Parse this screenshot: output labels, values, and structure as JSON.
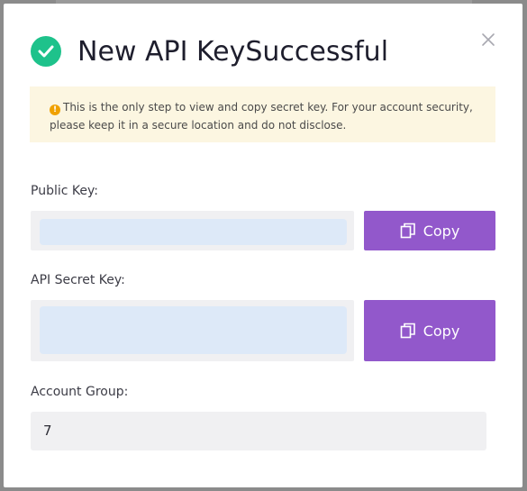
{
  "dialog": {
    "title": "New API KeySuccessful",
    "notice": "This is the only step to view and copy secret key. For your account security, please keep it in a secure location and do not disclose.",
    "public_key": {
      "label": "Public Key:",
      "value": "",
      "copy_label": "Copy"
    },
    "secret_key": {
      "label": "API Secret Key:",
      "value": "",
      "copy_label": "Copy"
    },
    "account_group": {
      "label": "Account Group:",
      "value": "7"
    }
  },
  "colors": {
    "success": "#1ec28b",
    "accent": "#9258cb",
    "notice_bg": "#fcf6e1",
    "warning": "#f0a100"
  },
  "icons": {
    "success": "check-circle-icon",
    "close": "close-icon",
    "notice": "exclamation-circle-icon",
    "copy": "copy-icon"
  }
}
